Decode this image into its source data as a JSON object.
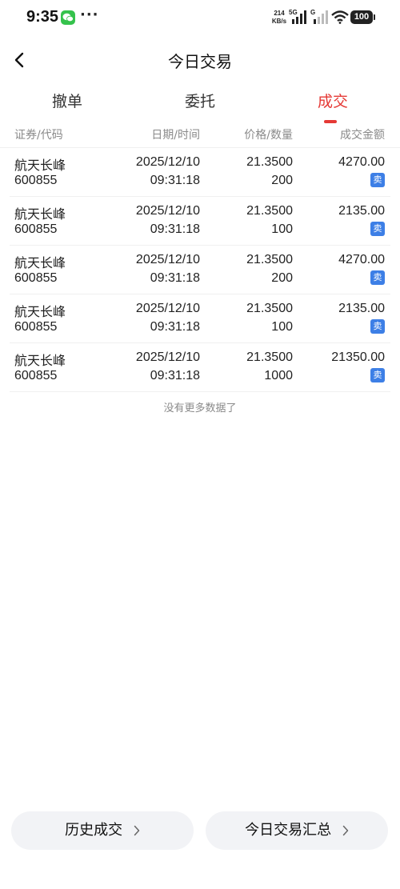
{
  "status_bar": {
    "time": "9:35",
    "dots": "···",
    "net_speed_value": "214",
    "net_speed_unit": "KB/s",
    "signal1_label": "5G",
    "signal2_label": "G",
    "battery": "100"
  },
  "header": {
    "title": "今日交易"
  },
  "tabs": [
    {
      "label": "撤单",
      "active": false
    },
    {
      "label": "委托",
      "active": false
    },
    {
      "label": "成交",
      "active": true
    }
  ],
  "columns": {
    "security": "证券/代码",
    "datetime": "日期/时间",
    "price_qty": "价格/数量",
    "amount": "成交金额"
  },
  "rows": [
    {
      "name": "航天长峰",
      "code": "600855",
      "date": "2025/12/10",
      "time": "09:31:18",
      "price": "21.3500",
      "qty": "200",
      "amount": "4270.00",
      "side": "卖"
    },
    {
      "name": "航天长峰",
      "code": "600855",
      "date": "2025/12/10",
      "time": "09:31:18",
      "price": "21.3500",
      "qty": "100",
      "amount": "2135.00",
      "side": "卖"
    },
    {
      "name": "航天长峰",
      "code": "600855",
      "date": "2025/12/10",
      "time": "09:31:18",
      "price": "21.3500",
      "qty": "200",
      "amount": "4270.00",
      "side": "卖"
    },
    {
      "name": "航天长峰",
      "code": "600855",
      "date": "2025/12/10",
      "time": "09:31:18",
      "price": "21.3500",
      "qty": "100",
      "amount": "2135.00",
      "side": "卖"
    },
    {
      "name": "航天长峰",
      "code": "600855",
      "date": "2025/12/10",
      "time": "09:31:18",
      "price": "21.3500",
      "qty": "1000",
      "amount": "21350.00",
      "side": "卖"
    }
  ],
  "footer_note": "没有更多数据了",
  "bottom_buttons": {
    "history": "历史成交",
    "summary": "今日交易汇总"
  },
  "colors": {
    "accent_red": "#e53935",
    "sell_badge": "#3d7fe6",
    "muted_text": "#8a8a8a",
    "button_bg": "#f2f3f6"
  },
  "icons": {
    "back": "chevron-left-icon",
    "chevron": "chevron-right-icon",
    "wechat": "wechat-icon",
    "wifi": "wifi-icon",
    "battery": "battery-icon"
  }
}
